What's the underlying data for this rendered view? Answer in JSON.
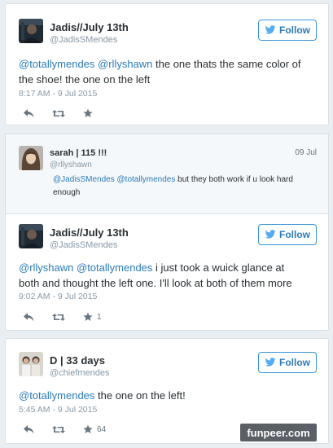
{
  "tweets": [
    {
      "name": "Jadis//July 13th",
      "handle": "@JadisSMendes",
      "follow_label": "Follow",
      "mentions": "@totallymendes @rllyshawn",
      "text_line1_rest": " the one thats the same color of",
      "text_line2": "the shoe! the one on the left",
      "time": "8:17 AM - 9 Jul 2015",
      "favorites": ""
    },
    {
      "name": "Jadis//July 13th",
      "handle": "@JadisSMendes",
      "follow_label": "Follow",
      "mentions": "@rllyshawn @totallymendes",
      "text_line1_rest": " i just took a wuick glance at",
      "text_line2": "both and thought the left one. I'll look at both of them more",
      "time": "9:02 AM - 9 Jul 2015",
      "favorites": "1"
    },
    {
      "name": "D | 33 days",
      "handle": "@chiefmendes",
      "follow_label": "Follow",
      "mentions": "@totallymendes",
      "text_line1_rest": " the one on the left!",
      "text_line2": "",
      "time": "5:45 AM - 9 Jul 2015",
      "favorites": "64"
    }
  ],
  "quoted": {
    "name": "sarah | 115 !!!",
    "handle": "@rllyshawn",
    "date": "09 Jul",
    "mentions": "@JadisSMendes @totallymendes",
    "text_rest": " but they both work if u look hard",
    "text_line2": "enough"
  },
  "icons": {
    "follow": "follow-bird-icon",
    "reply": "reply-icon",
    "retweet": "retweet-icon",
    "favorite": "favorite-star-icon"
  },
  "colors": {
    "link": "#2b7bb9",
    "muted": "#8899a6",
    "border": "#d8dfe5"
  },
  "watermark": "funpeer.com"
}
